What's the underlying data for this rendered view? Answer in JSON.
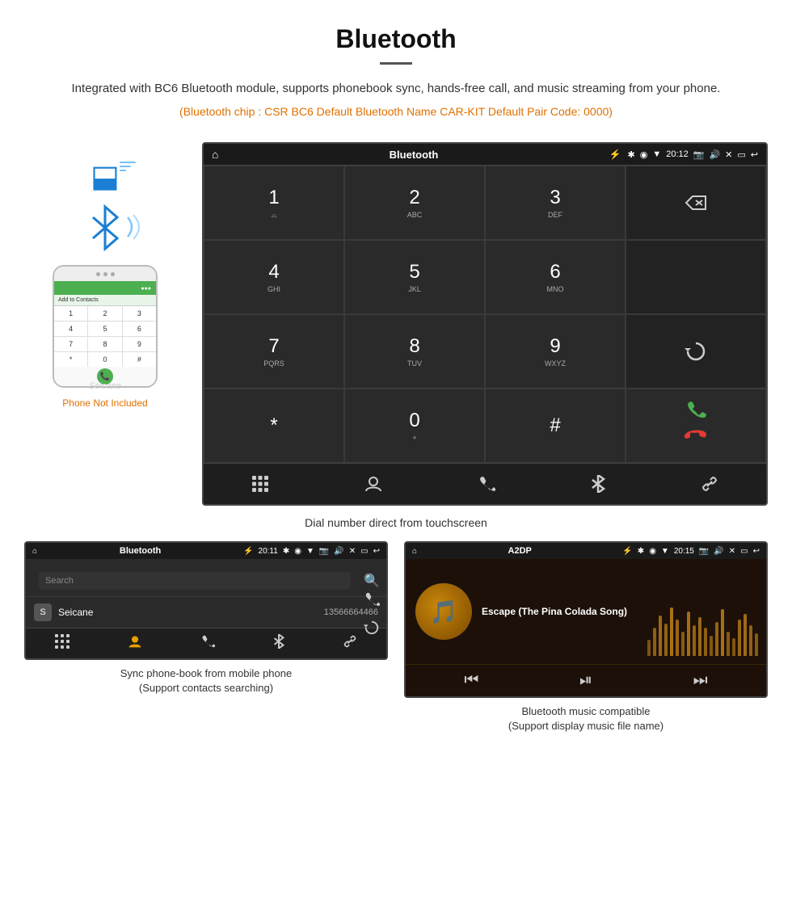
{
  "header": {
    "title": "Bluetooth",
    "description": "Integrated with BC6 Bluetooth module, supports phonebook sync, hands-free call, and music streaming from your phone.",
    "specs": "(Bluetooth chip : CSR BC6    Default Bluetooth Name CAR-KIT    Default Pair Code: 0000)"
  },
  "dial_screen": {
    "status_bar": {
      "title": "Bluetooth",
      "time": "20:12",
      "usb_symbol": "⚡"
    },
    "keypad": [
      {
        "num": "1",
        "sub": "⌓"
      },
      {
        "num": "2",
        "sub": "ABC"
      },
      {
        "num": "3",
        "sub": "DEF"
      },
      {
        "num": "⌫",
        "sub": ""
      },
      {
        "num": "4",
        "sub": "GHI"
      },
      {
        "num": "5",
        "sub": "JKL"
      },
      {
        "num": "6",
        "sub": "MNO"
      },
      {
        "num": "",
        "sub": ""
      },
      {
        "num": "7",
        "sub": "PQRS"
      },
      {
        "num": "8",
        "sub": "TUV"
      },
      {
        "num": "9",
        "sub": "WXYZ"
      },
      {
        "num": "↺",
        "sub": ""
      },
      {
        "num": "*",
        "sub": ""
      },
      {
        "num": "0",
        "sub": "+"
      },
      {
        "num": "#",
        "sub": ""
      },
      {
        "num": "CALL",
        "sub": ""
      }
    ],
    "bottom_nav": [
      "⊞",
      "👤",
      "📞",
      "✱",
      "🔗"
    ]
  },
  "phone": {
    "not_included": "Phone Not Included",
    "brand": "Seicane",
    "contact_label": "Add to Contacts",
    "dial_keys": [
      "1",
      "2",
      "3",
      "4",
      "5",
      "6",
      "*",
      "0",
      "#"
    ]
  },
  "dial_caption": "Dial number direct from touchscreen",
  "phonebook_screen": {
    "status": {
      "title": "Bluetooth",
      "time": "20:11"
    },
    "search_placeholder": "Search",
    "contacts": [
      {
        "avatar": "S",
        "name": "Seicane",
        "number": "13566664466"
      }
    ],
    "bottom_nav": [
      "⊞",
      "👤",
      "📞",
      "✱",
      "🔗"
    ]
  },
  "phonebook_caption": "Sync phone-book from mobile phone\n(Support contacts searching)",
  "music_screen": {
    "status": {
      "title": "A2DP",
      "time": "20:15"
    },
    "song_title": "Escape (The Pina Colada Song)",
    "eq_bars": [
      20,
      35,
      50,
      40,
      60,
      45,
      30,
      55,
      38,
      48,
      35,
      25,
      42,
      58,
      30,
      22,
      45,
      52,
      38,
      28
    ],
    "controls": [
      "⏮",
      "⏯",
      "⏭"
    ]
  },
  "music_caption": "Bluetooth music compatible\n(Support display music file name)"
}
